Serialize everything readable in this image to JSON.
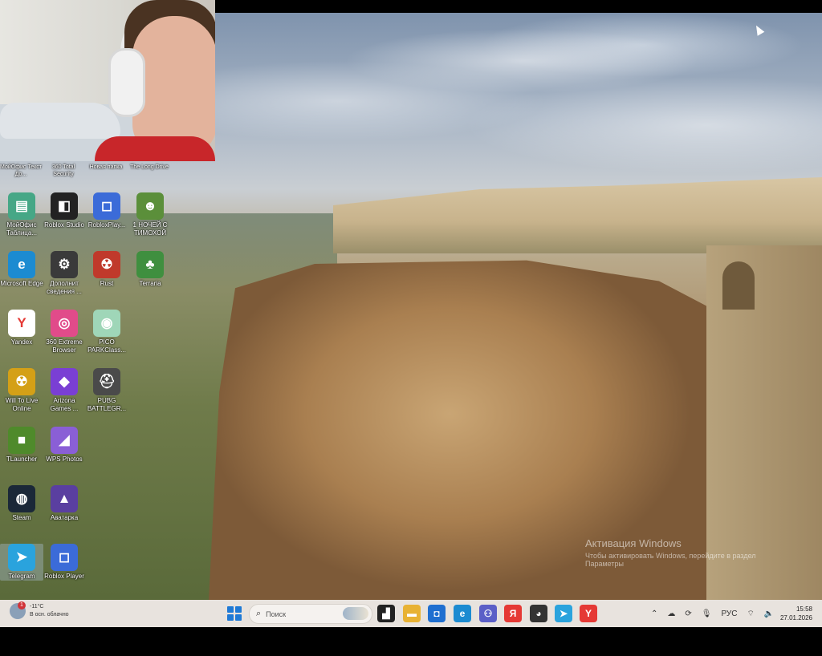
{
  "webcam": {
    "label": "webcam-overlay"
  },
  "top_labels": [
    {
      "label": "МойОфис Текст До..."
    },
    {
      "label": "360 Total Security"
    },
    {
      "label": "Новая папка"
    },
    {
      "label": "The Long Drive"
    }
  ],
  "desktop_icons": [
    {
      "label": "МойОфис Таблица...",
      "icon": "myoffice-sheet-icon",
      "color": "#46a786",
      "glyph": "▤"
    },
    {
      "label": "Roblox Studio",
      "icon": "roblox-studio-icon",
      "color": "#222222",
      "glyph": "◧"
    },
    {
      "label": "RobloxPlay...",
      "icon": "roblox-player-icon",
      "color": "#3b6bd8",
      "glyph": "◻"
    },
    {
      "label": "1 НОЧЕЙ С ТИМОХОЙ",
      "icon": "minecraft-skin-icon",
      "color": "#5b8f3a",
      "glyph": "☻"
    },
    {
      "label": "Microsoft Edge",
      "icon": "edge-icon",
      "color": "#1c8bd1",
      "glyph": "e"
    },
    {
      "label": "Дополнит сведения ...",
      "icon": "gear-icon",
      "color": "#3a3a3a",
      "glyph": "⚙"
    },
    {
      "label": "Rust",
      "icon": "rust-icon",
      "color": "#c0392b",
      "glyph": "☢"
    },
    {
      "label": "Terraria",
      "icon": "terraria-icon",
      "color": "#3f8f3f",
      "glyph": "♣"
    },
    {
      "label": "Yandex",
      "icon": "yandex-icon",
      "color": "#ffffff",
      "glyph": "Y"
    },
    {
      "label": "360 Extreme Browser",
      "icon": "360-browser-icon",
      "color": "#e14b8a",
      "glyph": "◎"
    },
    {
      "label": "PICO PARKClass...",
      "icon": "pico-park-icon",
      "color": "#9fd6b8",
      "glyph": "◉"
    },
    {
      "label": "Will To Live Online",
      "icon": "will-to-live-icon",
      "color": "#d4a017",
      "glyph": "☢"
    },
    {
      "label": "Arizona Games ...",
      "icon": "arizona-games-icon",
      "color": "#7a3fd4",
      "glyph": "◆"
    },
    {
      "label": "PUBG BATTLEGR...",
      "icon": "pubg-icon",
      "color": "#4a4a4a",
      "glyph": "⛑"
    },
    {
      "label": "TLauncher",
      "icon": "tlauncher-icon",
      "color": "#4f8a2b",
      "glyph": "■"
    },
    {
      "label": "WPS Photos",
      "icon": "wps-photos-icon",
      "color": "#8a5fd6",
      "glyph": "◢"
    },
    {
      "label": "Steam",
      "icon": "steam-icon",
      "color": "#1b2838",
      "glyph": "◍"
    },
    {
      "label": "Аватарка",
      "icon": "avatar-image-icon",
      "color": "#5a3fa0",
      "glyph": "▲"
    },
    {
      "label": "Telegram",
      "icon": "telegram-icon",
      "color": "#2aa3dd",
      "glyph": "➤"
    },
    {
      "label": "Roblox Player",
      "icon": "roblox-player-icon",
      "color": "#3b6bd8",
      "glyph": "◻"
    }
  ],
  "watermark": {
    "title": "Активация Windows",
    "line1": "Чтобы активировать Windows, перейдите в раздел",
    "line2": "Параметры"
  },
  "taskbar": {
    "weather": {
      "temp": "-11°C",
      "desc": "В осн. облачно",
      "badge": "1"
    },
    "search_placeholder": "Поиск",
    "apps": [
      {
        "name": "file-explorer-dark-icon",
        "glyph": "▟",
        "color": "#222222"
      },
      {
        "name": "folder-icon",
        "glyph": "▬",
        "color": "#e8b233"
      },
      {
        "name": "store-icon",
        "glyph": "◘",
        "color": "#1f6fd0"
      },
      {
        "name": "edge-icon",
        "glyph": "e",
        "color": "#1c8bd1"
      },
      {
        "name": "teams-icon",
        "glyph": "⚇",
        "color": "#5b5fc7"
      },
      {
        "name": "yandex-browser-icon",
        "glyph": "Я",
        "color": "#e53935"
      },
      {
        "name": "discord-like-icon",
        "glyph": "◕",
        "color": "#333333"
      },
      {
        "name": "telegram-icon",
        "glyph": "➤",
        "color": "#2aa3dd"
      },
      {
        "name": "yandex-icon",
        "glyph": "Y",
        "color": "#e53935"
      }
    ],
    "tray": {
      "language": "РУС"
    },
    "clock": {
      "time": "15:58",
      "date": "27.01.2026"
    }
  }
}
